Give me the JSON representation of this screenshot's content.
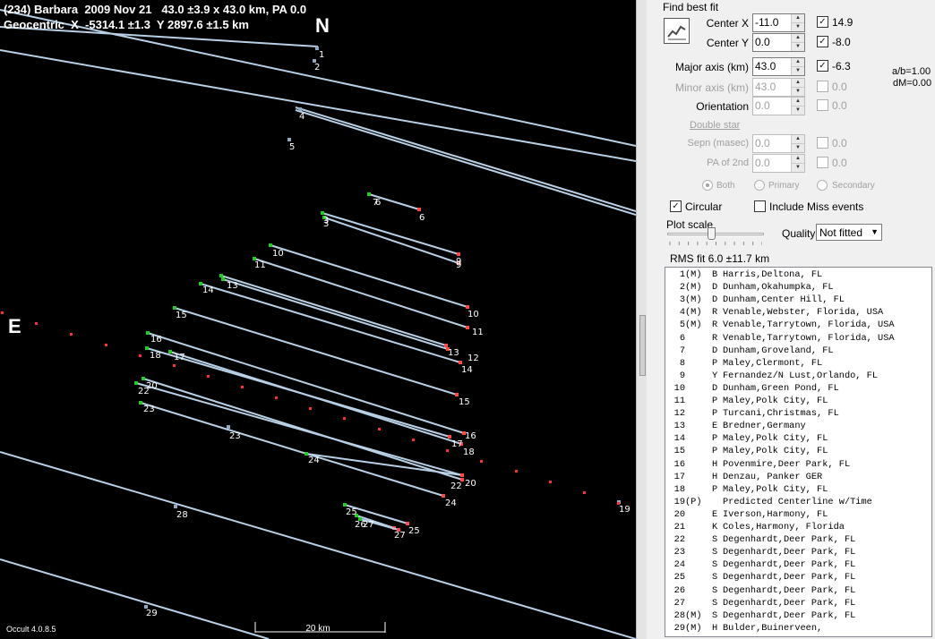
{
  "header": {
    "line1": "(234) Barbara  2009 Nov 21   43.0 ±3.9 x 43.0 km, PA 0.0",
    "line2": "Geocentric  X  -5314.1 ±1.3  Y 2897.6 ±1.5 km"
  },
  "plot": {
    "north_label": "N",
    "east_label": "E",
    "version": "Occult 4.0.8.5",
    "scale_label": "20 km",
    "chord_labels": [
      {
        "text": "1"
      },
      {
        "text": "2"
      },
      {
        "text": "4"
      },
      {
        "text": "5"
      },
      {
        "text": "7"
      },
      {
        "text": "6"
      },
      {
        "text": "6"
      },
      {
        "text": "3"
      },
      {
        "text": "9"
      },
      {
        "text": "3"
      },
      {
        "text": "9"
      },
      {
        "text": "10"
      },
      {
        "text": "11"
      },
      {
        "text": "14"
      },
      {
        "text": "13"
      },
      {
        "text": "10"
      },
      {
        "text": "11"
      },
      {
        "text": "15"
      },
      {
        "text": "16"
      },
      {
        "text": "18"
      },
      {
        "text": "17"
      },
      {
        "text": "13"
      },
      {
        "text": "12"
      },
      {
        "text": "14"
      },
      {
        "text": "22"
      },
      {
        "text": "20"
      },
      {
        "text": "15"
      },
      {
        "text": "23"
      },
      {
        "text": "23"
      },
      {
        "text": "16"
      },
      {
        "text": "17"
      },
      {
        "text": "18"
      },
      {
        "text": "24"
      },
      {
        "text": "22"
      },
      {
        "text": "20"
      },
      {
        "text": "24"
      },
      {
        "text": "28"
      },
      {
        "text": "19"
      },
      {
        "text": "25"
      },
      {
        "text": "26"
      },
      {
        "text": "27"
      },
      {
        "text": "27"
      },
      {
        "text": "25"
      },
      {
        "text": "29"
      }
    ]
  },
  "panel": {
    "find_best_fit": "Find best fit",
    "center_x": {
      "label": "Center X",
      "value": "-11.0",
      "checked": true,
      "delta": "14.9"
    },
    "center_y": {
      "label": "Center Y",
      "value": "0.0",
      "checked": true,
      "delta": "-8.0"
    },
    "major_axis": {
      "label": "Major axis (km)",
      "value": "43.0",
      "checked": true,
      "delta": "-6.3"
    },
    "minor_axis": {
      "label": "Minor axis (km)",
      "value": "43.0",
      "checked": false,
      "delta": "0.0"
    },
    "orientation": {
      "label": "Orientation",
      "value": "0.0",
      "checked": false,
      "delta": "0.0"
    },
    "ratio_ab": "a/b=1.00",
    "ratio_dm": "dM=0.00",
    "double_star": "Double star",
    "sepn": {
      "label": "Sepn (masec)",
      "value": "0.0",
      "delta": "0.0"
    },
    "pa2nd": {
      "label": "PA of 2nd",
      "value": "0.0",
      "delta": "0.0"
    },
    "radio_both": "Both",
    "radio_primary": "Primary",
    "radio_secondary": "Secondary",
    "circular_label": "Circular",
    "circular_checked": true,
    "include_miss_label": "Include Miss events",
    "include_miss_checked": false,
    "plot_scale_label": "Plot scale",
    "plot_scale_value": 0.45,
    "quality_label": "Quality",
    "quality_value": "Not fitted",
    "rms_fit": "RMS fit 6.0 ±11.7 km"
  },
  "observers": [
    {
      "num": "1",
      "flag": "(M)",
      "type": "B",
      "name": "Harris,Deltona, FL"
    },
    {
      "num": "2",
      "flag": "(M)",
      "type": "D",
      "name": "Dunham,Okahumpka, FL"
    },
    {
      "num": "3",
      "flag": "(M)",
      "type": "D",
      "name": "Dunham,Center Hill, FL"
    },
    {
      "num": "4",
      "flag": "(M)",
      "type": "R",
      "name": "Venable,Webster, Florida, USA"
    },
    {
      "num": "5",
      "flag": "(M)",
      "type": "R",
      "name": "Venable,Tarrytown, Florida, USA"
    },
    {
      "num": "6",
      "flag": "",
      "type": "R",
      "name": "Venable,Tarrytown, Florida, USA"
    },
    {
      "num": "7",
      "flag": "",
      "type": "D",
      "name": "Dunham,Groveland, FL"
    },
    {
      "num": "8",
      "flag": "",
      "type": "P",
      "name": "Maley,Clermont, FL"
    },
    {
      "num": "9",
      "flag": "",
      "type": "Y",
      "name": "Fernandez/N Lust,Orlando, FL"
    },
    {
      "num": "10",
      "flag": "",
      "type": "D",
      "name": "Dunham,Green Pond, FL"
    },
    {
      "num": "11",
      "flag": "",
      "type": "P",
      "name": "Maley,Polk City, FL"
    },
    {
      "num": "12",
      "flag": "",
      "type": "P",
      "name": "Turcani,Christmas, FL"
    },
    {
      "num": "13",
      "flag": "",
      "type": "E",
      "name": "Bredner,Germany"
    },
    {
      "num": "14",
      "flag": "",
      "type": "P",
      "name": "Maley,Polk City, FL"
    },
    {
      "num": "15",
      "flag": "",
      "type": "P",
      "name": "Maley,Polk City, FL"
    },
    {
      "num": "16",
      "flag": "",
      "type": "H",
      "name": "Povenmire,Deer Park, FL"
    },
    {
      "num": "17",
      "flag": "",
      "type": "H",
      "name": "Denzau, Panker GER"
    },
    {
      "num": "18",
      "flag": "",
      "type": "P",
      "name": "Maley,Polk City, FL"
    },
    {
      "num": "19",
      "flag": "(P)",
      "type": "",
      "name": "Predicted Centerline w/Time"
    },
    {
      "num": "20",
      "flag": "",
      "type": "E",
      "name": "Iverson,Harmony, FL"
    },
    {
      "num": "21",
      "flag": "",
      "type": "K",
      "name": "Coles,Harmony, Florida"
    },
    {
      "num": "22",
      "flag": "",
      "type": "S",
      "name": "Degenhardt,Deer Park, FL"
    },
    {
      "num": "23",
      "flag": "",
      "type": "S",
      "name": "Degenhardt,Deer Park, FL"
    },
    {
      "num": "24",
      "flag": "",
      "type": "S",
      "name": "Degenhardt,Deer Park, FL"
    },
    {
      "num": "25",
      "flag": "",
      "type": "S",
      "name": "Degenhardt,Deer Park, FL"
    },
    {
      "num": "26",
      "flag": "",
      "type": "S",
      "name": "Degenhardt,Deer Park, FL"
    },
    {
      "num": "27",
      "flag": "",
      "type": "S",
      "name": "Degenhardt,Deer Park, FL"
    },
    {
      "num": "28",
      "flag": "(M)",
      "type": "S",
      "name": "Degenhardt,Deer Park, FL"
    },
    {
      "num": "29",
      "flag": "(M)",
      "type": "H",
      "name": "Bulder,Buinerveen,"
    }
  ]
}
